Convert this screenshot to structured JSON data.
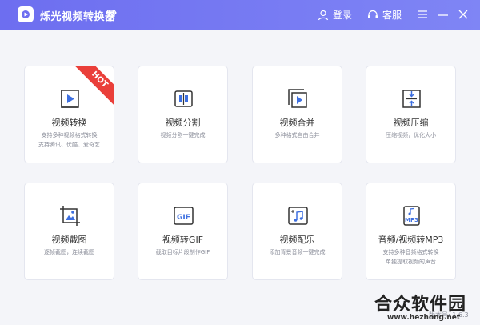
{
  "window": {
    "title": "烁光视频转换器"
  },
  "header": {
    "login_label": "登录",
    "service_label": "客服"
  },
  "cards": [
    {
      "title": "视频转换",
      "desc1": "支持多种视频格式转换",
      "desc2": "支持腾讯、优酷、爱奇艺",
      "badge": "HOT"
    },
    {
      "title": "视频分割",
      "desc1": "视频分割一键完成",
      "desc2": ""
    },
    {
      "title": "视频合并",
      "desc1": "多种格式自由合并",
      "desc2": ""
    },
    {
      "title": "视频压缩",
      "desc1": "压缩视频，优化大小",
      "desc2": ""
    },
    {
      "title": "视频截图",
      "desc1": "逐帧截图，连续截图",
      "desc2": ""
    },
    {
      "title": "视频转GIF",
      "desc1": "截取目标片段制作GIF",
      "desc2": ""
    },
    {
      "title": "视频配乐",
      "desc1": "添加背景音频一键完成",
      "desc2": ""
    },
    {
      "title": "音频/视频转MP3",
      "desc1": "支持多种音频格式转换",
      "desc2": "单独提取视频的声音"
    }
  ],
  "footer": {
    "version": "版本号: 1.6.3"
  },
  "watermark": {
    "title": "合众软件园",
    "url": "www.hezhong.net"
  },
  "colors": {
    "header": "#7077f2",
    "accent": "#5565d8",
    "hot": "#ea3f3a"
  }
}
